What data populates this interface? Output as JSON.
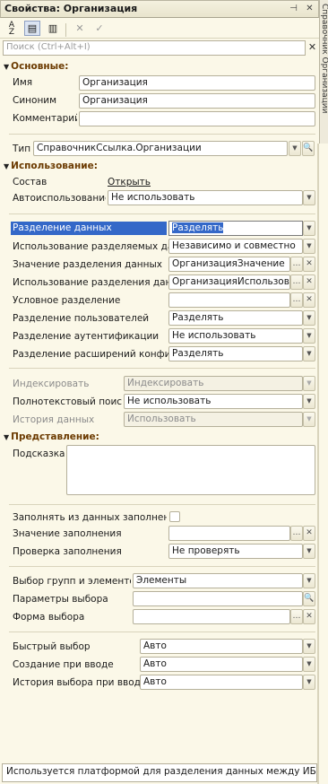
{
  "window": {
    "title": "Свойства: Организация",
    "side_tab": "Справочник Организации"
  },
  "search": {
    "placeholder": "Поиск (Ctrl+Alt+I)"
  },
  "sections": {
    "basic": "Основные:",
    "usage": "Использование:",
    "presentation": "Представление:"
  },
  "basic": {
    "name_label": "Имя",
    "name_value": "Организация",
    "synonym_label": "Синоним",
    "synonym_value": "Организация",
    "comment_label": "Комментарий",
    "comment_value": "",
    "type_label": "Тип",
    "type_value": "СправочникСсылка.Организации"
  },
  "usage": {
    "composition_label": "Состав",
    "composition_link": "Открыть",
    "autouse_label": "Автоиспользование",
    "autouse_value": "Не использовать",
    "sep_data_label": "Разделение данных",
    "sep_data_value": "Разделять",
    "sep_shared_label": "Использование разделяемых данных",
    "sep_shared_value": "Независимо и совместно",
    "sep_value_label": "Значение разделения данных",
    "sep_value_value": "ОрганизацияЗначение",
    "sep_use_label": "Использование разделения данных",
    "sep_use_value": "ОрганизацияИспользование",
    "cond_sep_label": "Условное разделение",
    "cond_sep_value": "",
    "user_sep_label": "Разделение пользователей",
    "user_sep_value": "Разделять",
    "auth_sep_label": "Разделение аутентификации",
    "auth_sep_value": "Не использовать",
    "ext_sep_label": "Разделение расширений конфигурации",
    "ext_sep_value": "Разделять",
    "index_label": "Индексировать",
    "index_value": "Индексировать",
    "fts_label": "Полнотекстовый поиск",
    "fts_value": "Не использовать",
    "history_label": "История данных",
    "history_value": "Использовать"
  },
  "presentation": {
    "hint_label": "Подсказка",
    "hint_value": "",
    "fill_from_label": "Заполнять из данных заполнения",
    "fill_value_label": "Значение заполнения",
    "fill_value_value": "",
    "fill_check_label": "Проверка заполнения",
    "fill_check_value": "Не проверять",
    "choice_groups_label": "Выбор групп и элементов",
    "choice_groups_value": "Элементы",
    "choice_params_label": "Параметры выбора",
    "choice_params_value": "",
    "choice_form_label": "Форма выбора",
    "choice_form_value": "",
    "quick_choice_label": "Быстрый выбор",
    "quick_choice_value": "Авто",
    "create_on_input_label": "Создание при вводе",
    "create_on_input_value": "Авто",
    "choice_history_label": "История выбора при вводе",
    "choice_history_value": "Авто"
  },
  "status": {
    "text": "Используется платформой для разделения данных между ИБ"
  }
}
